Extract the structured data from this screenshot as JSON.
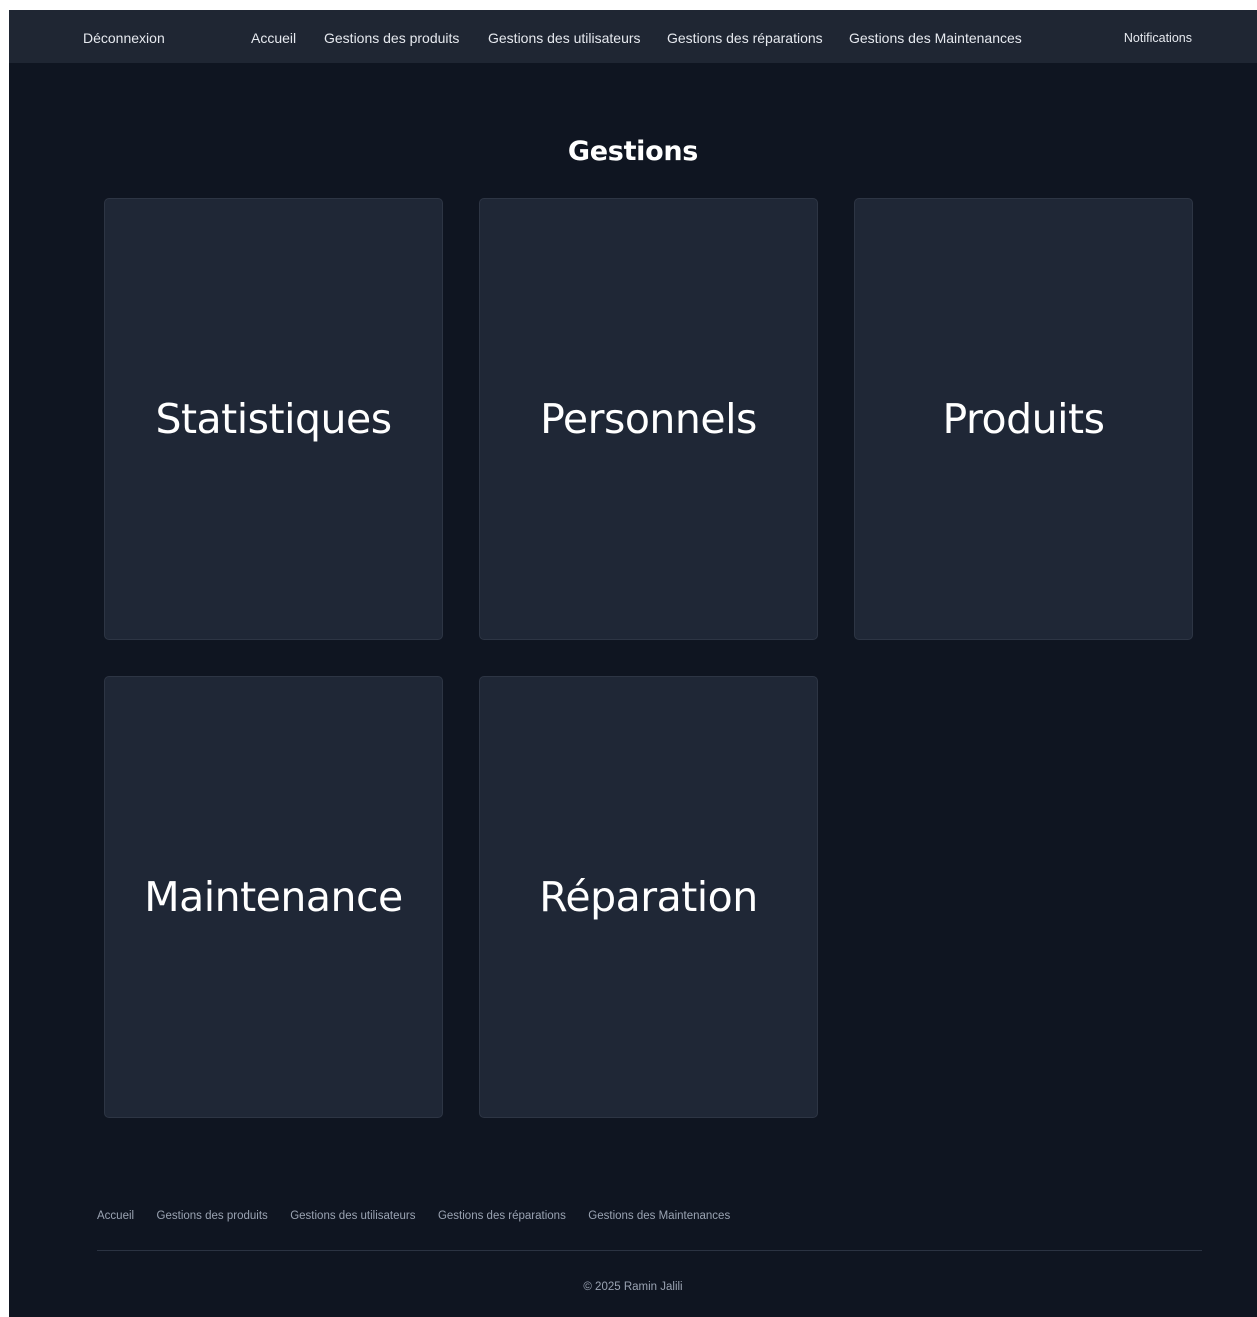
{
  "header": {
    "logout_label": "Déconnexion",
    "nav": [
      "Accueil",
      "Gestions des produits",
      "Gestions des utilisateurs",
      "Gestions des réparations",
      "Gestions des Maintenances"
    ],
    "notifications_label": "Notifications"
  },
  "main": {
    "title": "Gestions",
    "cards": [
      "Statistiques",
      "Personnels",
      "Produits",
      "Maintenance",
      "Réparation"
    ]
  },
  "footer": {
    "links": [
      "Accueil",
      "Gestions des produits",
      "Gestions des utilisateurs",
      "Gestions des réparations",
      "Gestions des Maintenances"
    ],
    "copyright": "© 2025 Ramin Jalili"
  },
  "colors": {
    "background": "#0f1521",
    "navbar": "#1f2633",
    "card": "#1f2736",
    "text": "#ffffff",
    "muted_text": "#9aa3b2"
  }
}
